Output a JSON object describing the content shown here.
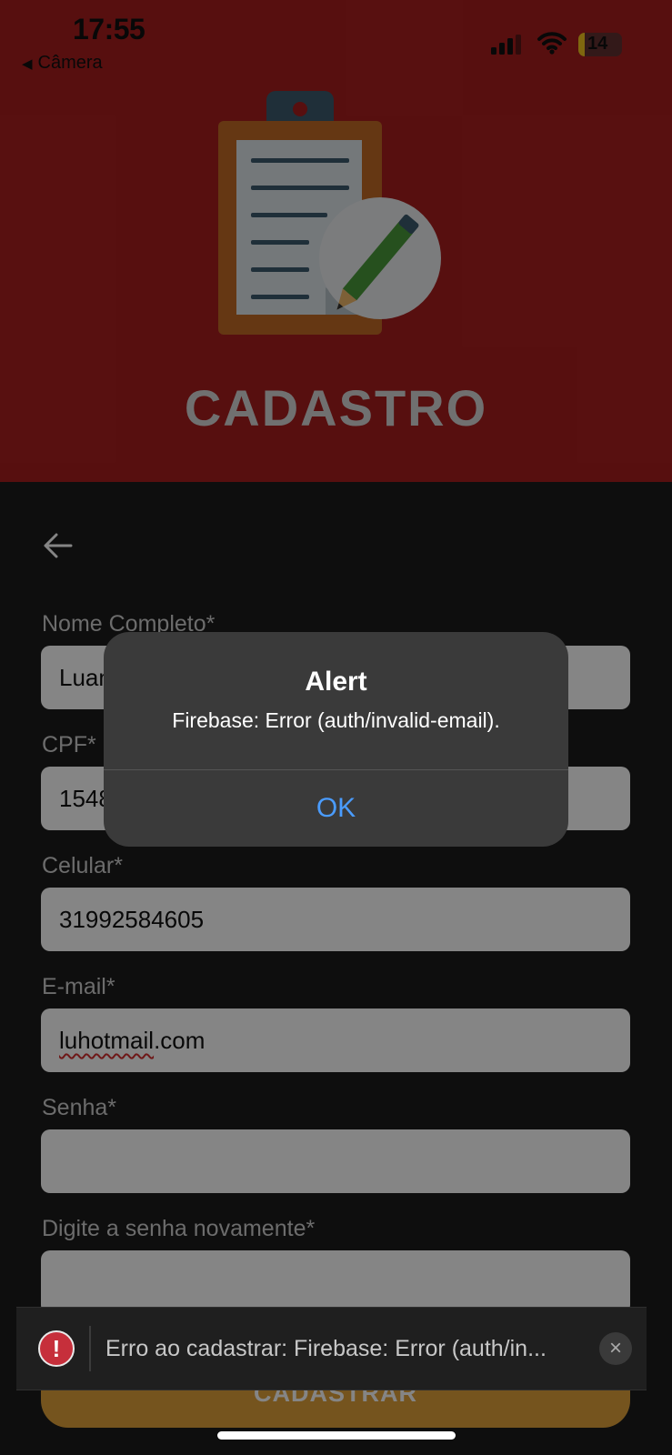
{
  "status_bar": {
    "time": "17:55",
    "back_app": "Câmera",
    "battery": "14"
  },
  "header": {
    "title": "CADASTRO",
    "background": "#a81e1e"
  },
  "form": {
    "fields": [
      {
        "label": "Nome Completo*",
        "value": "Luan"
      },
      {
        "label": "CPF*",
        "value": "1548"
      },
      {
        "label": "Celular*",
        "value": "31992584605"
      },
      {
        "label": "E-mail*",
        "value_underlined": "luhotmail",
        "value_rest": ".com"
      },
      {
        "label": "Senha*",
        "value": ""
      },
      {
        "label": "Digite a senha novamente*",
        "value": ""
      }
    ],
    "submit_label": "CADASTRAR"
  },
  "alert": {
    "title": "Alert",
    "message": "Firebase: Error (auth/invalid-email).",
    "ok_label": "OK"
  },
  "toast": {
    "message": "Erro ao cadastrar: Firebase: Error (auth/in...",
    "icon": "exclamation-icon"
  }
}
